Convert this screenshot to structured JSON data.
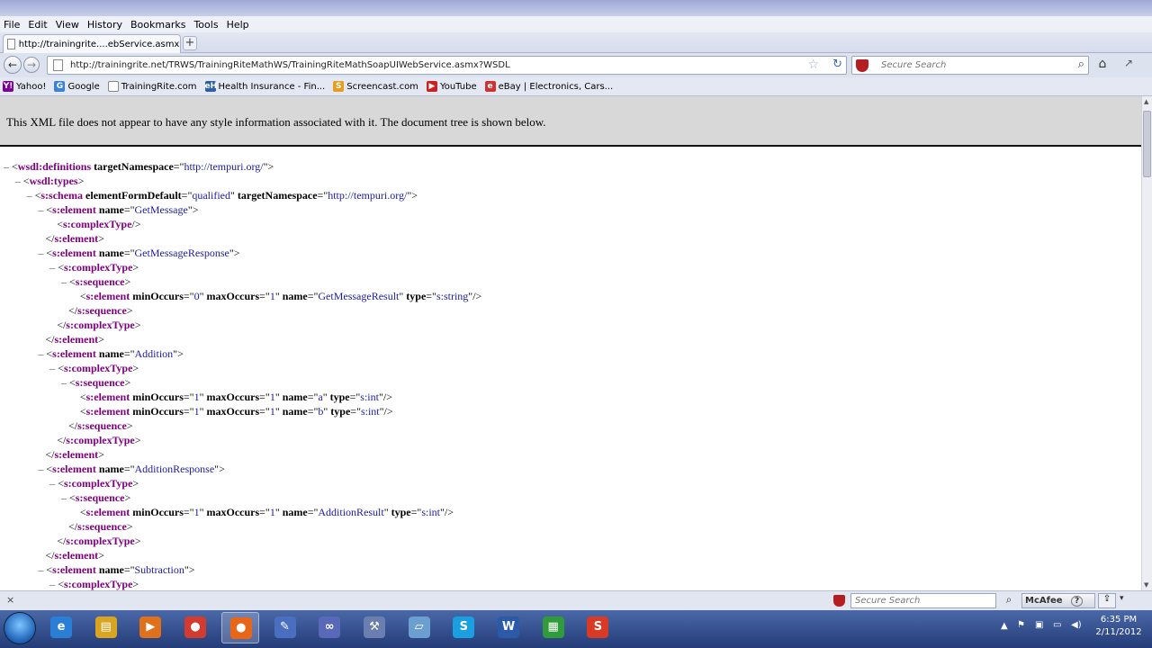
{
  "menu": [
    "File",
    "Edit",
    "View",
    "History",
    "Bookmarks",
    "Tools",
    "Help"
  ],
  "tab": {
    "title": "http://trainingrite....ebService.asmx?WSDL",
    "new_tab": "+"
  },
  "nav": {
    "back": "←",
    "forward": "→",
    "url": "http://trainingrite.net/TRWS/TrainingRiteMathWS/TrainingRiteMathSoapUIWebService.asmx?WSDL",
    "bookmark_star": "☆",
    "reload": "↻",
    "search_placeholder": "Secure Search",
    "search_icon": "⌕",
    "home": "⌂",
    "addon": "↗"
  },
  "bookmarks": [
    {
      "label": "Yahoo!",
      "icon": "Y!",
      "color": "#7b0099"
    },
    {
      "label": "Google",
      "icon": "G",
      "color": "#3b82d6"
    },
    {
      "label": "TrainingRite.com",
      "icon": "",
      "color": "#ffffff"
    },
    {
      "label": "Health Insurance - Fin...",
      "icon": "eH",
      "color": "#2c5fa8"
    },
    {
      "label": "Screencast.com",
      "icon": "S",
      "color": "#e89b1e"
    },
    {
      "label": "YouTube",
      "icon": "▶",
      "color": "#cc2020"
    },
    {
      "label": "eBay | Electronics, Cars...",
      "icon": "e",
      "color": "#d03030"
    }
  ],
  "xml_notice": "This XML file does not appear to have any style information associated with it. The document tree is shown below.",
  "tree_lines": [
    {
      "indent": 0,
      "toggle": "–",
      "parts": [
        [
          "pn",
          "<"
        ],
        [
          "tg",
          "wsdl:definitions"
        ],
        [
          "pn",
          " "
        ],
        [
          "at",
          "targetNamespace"
        ],
        [
          "pn",
          "=\""
        ],
        [
          "av",
          "http://tempuri.org/"
        ],
        [
          "pn",
          "\">"
        ]
      ]
    },
    {
      "indent": 1,
      "toggle": "–",
      "parts": [
        [
          "pn",
          "<"
        ],
        [
          "tg",
          "wsdl:types"
        ],
        [
          "pn",
          ">"
        ]
      ]
    },
    {
      "indent": 2,
      "toggle": "–",
      "parts": [
        [
          "pn",
          "<"
        ],
        [
          "tg",
          "s:schema"
        ],
        [
          "pn",
          " "
        ],
        [
          "at",
          "elementFormDefault"
        ],
        [
          "pn",
          "=\""
        ],
        [
          "av",
          "qualified"
        ],
        [
          "pn",
          "\" "
        ],
        [
          "at",
          "targetNamespace"
        ],
        [
          "pn",
          "=\""
        ],
        [
          "av",
          "http://tempuri.org/"
        ],
        [
          "pn",
          "\">"
        ]
      ]
    },
    {
      "indent": 3,
      "toggle": "–",
      "parts": [
        [
          "pn",
          "<"
        ],
        [
          "tg",
          "s:element"
        ],
        [
          "pn",
          " "
        ],
        [
          "at",
          "name"
        ],
        [
          "pn",
          "=\""
        ],
        [
          "av",
          "GetMessage"
        ],
        [
          "pn",
          "\">"
        ]
      ]
    },
    {
      "indent": 4,
      "toggle": "",
      "parts": [
        [
          "pn",
          "<"
        ],
        [
          "tg",
          "s:complexType"
        ],
        [
          "pn",
          "/>"
        ]
      ]
    },
    {
      "indent": 3,
      "toggle": "",
      "parts": [
        [
          "pn",
          "</"
        ],
        [
          "tg",
          "s:element"
        ],
        [
          "pn",
          ">"
        ]
      ]
    },
    {
      "indent": 3,
      "toggle": "–",
      "parts": [
        [
          "pn",
          "<"
        ],
        [
          "tg",
          "s:element"
        ],
        [
          "pn",
          " "
        ],
        [
          "at",
          "name"
        ],
        [
          "pn",
          "=\""
        ],
        [
          "av",
          "GetMessageResponse"
        ],
        [
          "pn",
          "\">"
        ]
      ]
    },
    {
      "indent": 4,
      "toggle": "–",
      "parts": [
        [
          "pn",
          "<"
        ],
        [
          "tg",
          "s:complexType"
        ],
        [
          "pn",
          ">"
        ]
      ]
    },
    {
      "indent": 5,
      "toggle": "–",
      "parts": [
        [
          "pn",
          "<"
        ],
        [
          "tg",
          "s:sequence"
        ],
        [
          "pn",
          ">"
        ]
      ]
    },
    {
      "indent": 6,
      "toggle": "",
      "parts": [
        [
          "pn",
          "<"
        ],
        [
          "tg",
          "s:element"
        ],
        [
          "pn",
          " "
        ],
        [
          "at",
          "minOccurs"
        ],
        [
          "pn",
          "=\""
        ],
        [
          "av",
          "0"
        ],
        [
          "pn",
          "\" "
        ],
        [
          "at",
          "maxOccurs"
        ],
        [
          "pn",
          "=\""
        ],
        [
          "av",
          "1"
        ],
        [
          "pn",
          "\" "
        ],
        [
          "at",
          "name"
        ],
        [
          "pn",
          "=\""
        ],
        [
          "av",
          "GetMessageResult"
        ],
        [
          "pn",
          "\" "
        ],
        [
          "at",
          "type"
        ],
        [
          "pn",
          "=\""
        ],
        [
          "av",
          "s:string"
        ],
        [
          "pn",
          "\"/>"
        ]
      ]
    },
    {
      "indent": 5,
      "toggle": "",
      "parts": [
        [
          "pn",
          "</"
        ],
        [
          "tg",
          "s:sequence"
        ],
        [
          "pn",
          ">"
        ]
      ]
    },
    {
      "indent": 4,
      "toggle": "",
      "parts": [
        [
          "pn",
          "</"
        ],
        [
          "tg",
          "s:complexType"
        ],
        [
          "pn",
          ">"
        ]
      ]
    },
    {
      "indent": 3,
      "toggle": "",
      "parts": [
        [
          "pn",
          "</"
        ],
        [
          "tg",
          "s:element"
        ],
        [
          "pn",
          ">"
        ]
      ]
    },
    {
      "indent": 3,
      "toggle": "–",
      "parts": [
        [
          "pn",
          "<"
        ],
        [
          "tg",
          "s:element"
        ],
        [
          "pn",
          " "
        ],
        [
          "at",
          "name"
        ],
        [
          "pn",
          "=\""
        ],
        [
          "av",
          "Addition"
        ],
        [
          "pn",
          "\">"
        ]
      ]
    },
    {
      "indent": 4,
      "toggle": "–",
      "parts": [
        [
          "pn",
          "<"
        ],
        [
          "tg",
          "s:complexType"
        ],
        [
          "pn",
          ">"
        ]
      ]
    },
    {
      "indent": 5,
      "toggle": "–",
      "parts": [
        [
          "pn",
          "<"
        ],
        [
          "tg",
          "s:sequence"
        ],
        [
          "pn",
          ">"
        ]
      ]
    },
    {
      "indent": 6,
      "toggle": "",
      "parts": [
        [
          "pn",
          "<"
        ],
        [
          "tg",
          "s:element"
        ],
        [
          "pn",
          " "
        ],
        [
          "at",
          "minOccurs"
        ],
        [
          "pn",
          "=\""
        ],
        [
          "av",
          "1"
        ],
        [
          "pn",
          "\" "
        ],
        [
          "at",
          "maxOccurs"
        ],
        [
          "pn",
          "=\""
        ],
        [
          "av",
          "1"
        ],
        [
          "pn",
          "\" "
        ],
        [
          "at",
          "name"
        ],
        [
          "pn",
          "=\""
        ],
        [
          "av",
          "a"
        ],
        [
          "pn",
          "\" "
        ],
        [
          "at",
          "type"
        ],
        [
          "pn",
          "=\""
        ],
        [
          "av",
          "s:int"
        ],
        [
          "pn",
          "\"/>"
        ]
      ]
    },
    {
      "indent": 6,
      "toggle": "",
      "parts": [
        [
          "pn",
          "<"
        ],
        [
          "tg",
          "s:element"
        ],
        [
          "pn",
          " "
        ],
        [
          "at",
          "minOccurs"
        ],
        [
          "pn",
          "=\""
        ],
        [
          "av",
          "1"
        ],
        [
          "pn",
          "\" "
        ],
        [
          "at",
          "maxOccurs"
        ],
        [
          "pn",
          "=\""
        ],
        [
          "av",
          "1"
        ],
        [
          "pn",
          "\" "
        ],
        [
          "at",
          "name"
        ],
        [
          "pn",
          "=\""
        ],
        [
          "av",
          "b"
        ],
        [
          "pn",
          "\" "
        ],
        [
          "at",
          "type"
        ],
        [
          "pn",
          "=\""
        ],
        [
          "av",
          "s:int"
        ],
        [
          "pn",
          "\"/>"
        ]
      ]
    },
    {
      "indent": 5,
      "toggle": "",
      "parts": [
        [
          "pn",
          "</"
        ],
        [
          "tg",
          "s:sequence"
        ],
        [
          "pn",
          ">"
        ]
      ]
    },
    {
      "indent": 4,
      "toggle": "",
      "parts": [
        [
          "pn",
          "</"
        ],
        [
          "tg",
          "s:complexType"
        ],
        [
          "pn",
          ">"
        ]
      ]
    },
    {
      "indent": 3,
      "toggle": "",
      "parts": [
        [
          "pn",
          "</"
        ],
        [
          "tg",
          "s:element"
        ],
        [
          "pn",
          ">"
        ]
      ]
    },
    {
      "indent": 3,
      "toggle": "–",
      "parts": [
        [
          "pn",
          "<"
        ],
        [
          "tg",
          "s:element"
        ],
        [
          "pn",
          " "
        ],
        [
          "at",
          "name"
        ],
        [
          "pn",
          "=\""
        ],
        [
          "av",
          "AdditionResponse"
        ],
        [
          "pn",
          "\">"
        ]
      ]
    },
    {
      "indent": 4,
      "toggle": "–",
      "parts": [
        [
          "pn",
          "<"
        ],
        [
          "tg",
          "s:complexType"
        ],
        [
          "pn",
          ">"
        ]
      ]
    },
    {
      "indent": 5,
      "toggle": "–",
      "parts": [
        [
          "pn",
          "<"
        ],
        [
          "tg",
          "s:sequence"
        ],
        [
          "pn",
          ">"
        ]
      ]
    },
    {
      "indent": 6,
      "toggle": "",
      "parts": [
        [
          "pn",
          "<"
        ],
        [
          "tg",
          "s:element"
        ],
        [
          "pn",
          " "
        ],
        [
          "at",
          "minOccurs"
        ],
        [
          "pn",
          "=\""
        ],
        [
          "av",
          "1"
        ],
        [
          "pn",
          "\" "
        ],
        [
          "at",
          "maxOccurs"
        ],
        [
          "pn",
          "=\""
        ],
        [
          "av",
          "1"
        ],
        [
          "pn",
          "\" "
        ],
        [
          "at",
          "name"
        ],
        [
          "pn",
          "=\""
        ],
        [
          "av",
          "AdditionResult"
        ],
        [
          "pn",
          "\" "
        ],
        [
          "at",
          "type"
        ],
        [
          "pn",
          "=\""
        ],
        [
          "av",
          "s:int"
        ],
        [
          "pn",
          "\"/>"
        ]
      ]
    },
    {
      "indent": 5,
      "toggle": "",
      "parts": [
        [
          "pn",
          "</"
        ],
        [
          "tg",
          "s:sequence"
        ],
        [
          "pn",
          ">"
        ]
      ]
    },
    {
      "indent": 4,
      "toggle": "",
      "parts": [
        [
          "pn",
          "</"
        ],
        [
          "tg",
          "s:complexType"
        ],
        [
          "pn",
          ">"
        ]
      ]
    },
    {
      "indent": 3,
      "toggle": "",
      "parts": [
        [
          "pn",
          "</"
        ],
        [
          "tg",
          "s:element"
        ],
        [
          "pn",
          ">"
        ]
      ]
    },
    {
      "indent": 3,
      "toggle": "–",
      "parts": [
        [
          "pn",
          "<"
        ],
        [
          "tg",
          "s:element"
        ],
        [
          "pn",
          " "
        ],
        [
          "at",
          "name"
        ],
        [
          "pn",
          "=\""
        ],
        [
          "av",
          "Subtraction"
        ],
        [
          "pn",
          "\">"
        ]
      ]
    },
    {
      "indent": 4,
      "toggle": "–",
      "parts": [
        [
          "pn",
          "<"
        ],
        [
          "tg",
          "s:complexType"
        ],
        [
          "pn",
          ">"
        ]
      ]
    }
  ],
  "status": {
    "close": "×",
    "search_placeholder": "Secure Search",
    "search_icon": "⌕",
    "mcafee": "McAfee",
    "mcafee_help": "?",
    "menu_arrow": "▾"
  },
  "taskbar": {
    "apps": [
      {
        "name": "ie",
        "glyph": "e",
        "color": "#2a7fd4",
        "active": false
      },
      {
        "name": "explorer",
        "glyph": "▤",
        "color": "#d9a520",
        "active": false
      },
      {
        "name": "media-player",
        "glyph": "▶",
        "color": "#e0701a",
        "active": false
      },
      {
        "name": "chrome",
        "glyph": "●",
        "color": "#d23b2e",
        "active": false
      },
      {
        "name": "firefox",
        "glyph": "●",
        "color": "#e8661a",
        "active": true
      },
      {
        "name": "pen-tool",
        "glyph": "✎",
        "color": "#4a6fc0",
        "active": false
      },
      {
        "name": "link-app",
        "glyph": "∞",
        "color": "#5a68b8",
        "active": false
      },
      {
        "name": "tools",
        "glyph": "⚒",
        "color": "#6a7fb0",
        "active": false
      },
      {
        "name": "notepad",
        "glyph": "▱",
        "color": "#6a9fd0",
        "active": false
      },
      {
        "name": "skype",
        "glyph": "S",
        "color": "#1aa0e0",
        "active": false
      },
      {
        "name": "word",
        "glyph": "W",
        "color": "#2a5aa8",
        "active": false
      },
      {
        "name": "spreadsheet",
        "glyph": "▦",
        "color": "#2f9b3a",
        "active": false
      },
      {
        "name": "snagit",
        "glyph": "S",
        "color": "#d83a26",
        "active": false
      }
    ],
    "time": "6:35 PM",
    "date": "2/11/2012"
  }
}
